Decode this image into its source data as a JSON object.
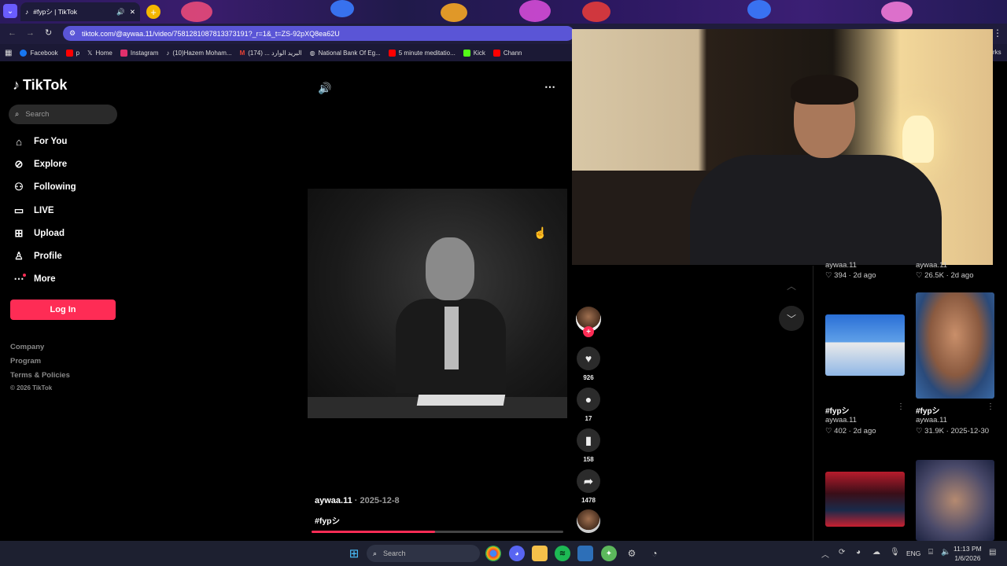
{
  "browser": {
    "tab_title": "#fypシ | TikTok",
    "url": "tiktok.com/@aywaa.11/video/7581281087813373191?_r=1&_t=ZS-92pXQ8ea62U",
    "bookmarks": [
      {
        "label": "Facebook",
        "color": "#1877f2"
      },
      {
        "label": "p",
        "color": "#ff0000"
      },
      {
        "label": "Home",
        "color": "#ffffff"
      },
      {
        "label": "Instagram",
        "color": "#e1306c"
      },
      {
        "label": "(10)Hazem Moham...",
        "color": "#000000"
      },
      {
        "label": "(174) ... البريد الوارد",
        "color": "#ea4335"
      },
      {
        "label": "National Bank Of Eg...",
        "color": "#ffffff"
      },
      {
        "label": "5 minute meditatio...",
        "color": "#ff0000"
      },
      {
        "label": "Kick",
        "color": "#53fc18"
      },
      {
        "label": "Chann",
        "color": "#ff0000"
      }
    ],
    "bookmarks_overflow": "rks"
  },
  "sidebar": {
    "logo": "TikTok",
    "search_placeholder": "Search",
    "nav": [
      {
        "label": "For You",
        "icon": "home-icon"
      },
      {
        "label": "Explore",
        "icon": "compass-icon"
      },
      {
        "label": "Following",
        "icon": "following-icon"
      },
      {
        "label": "LIVE",
        "icon": "live-icon"
      },
      {
        "label": "Upload",
        "icon": "upload-icon"
      },
      {
        "label": "Profile",
        "icon": "profile-icon"
      },
      {
        "label": "More",
        "icon": "more-icon"
      }
    ],
    "login": "Log In",
    "footer": [
      "Company",
      "Program",
      "Terms & Policies"
    ],
    "copyright": "© 2026 TikTok"
  },
  "video": {
    "author": "aywaa.11",
    "date": "· 2025-12-8",
    "caption": "#fypシ",
    "progress": 0.49
  },
  "actions": {
    "likes": "926",
    "comments": "17",
    "saves": "158",
    "shares": "1478"
  },
  "grid": {
    "row0": [
      {
        "user": "aywaa.11",
        "likes": "394",
        "age": "· 2d ago"
      },
      {
        "user": "aywaa.11",
        "likes": "26.5K",
        "age": "· 2d ago"
      }
    ],
    "row1": [
      {
        "title": "#fypシ",
        "user": "aywaa.11",
        "likes": "402",
        "age": "· 2d ago"
      },
      {
        "title": "#fypシ",
        "user": "aywaa.11",
        "likes": "31.9K",
        "age": "· 2025-12-30"
      }
    ]
  },
  "taskbar": {
    "search": "Search",
    "lang": "ENG",
    "time": "11:13 PM",
    "date": "1/6/2026"
  },
  "colors": {
    "accent": "#fe2c55",
    "address_bar": "#5a55d6"
  }
}
